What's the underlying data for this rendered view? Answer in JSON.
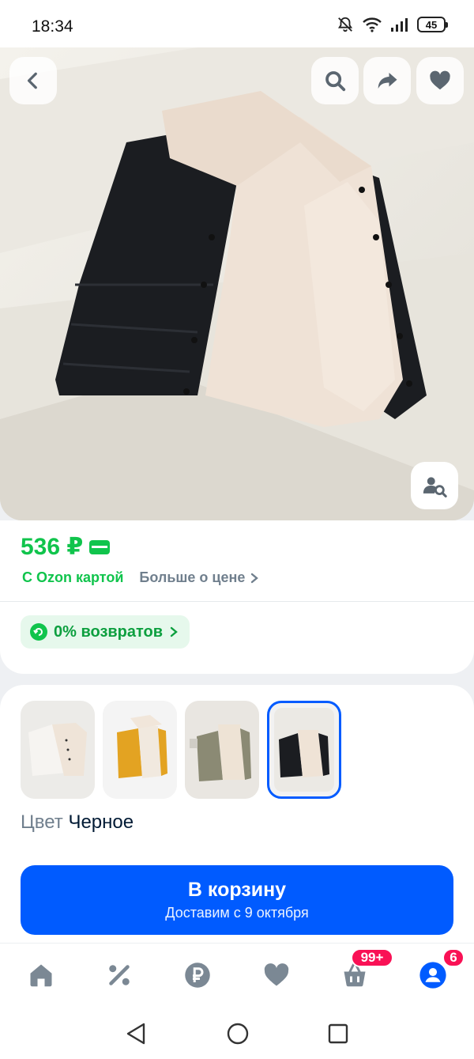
{
  "status_bar": {
    "time": "18:34",
    "battery": "45"
  },
  "product": {
    "price": "536 ₽",
    "price_note": "С Ozon картой",
    "more_price": "Больше о цене",
    "returns": "0% возвратов"
  },
  "variants": {
    "color_label": "Цвет",
    "color_value": "Черное",
    "options": [
      "white",
      "yellow",
      "olive",
      "black"
    ],
    "selected_index": 3
  },
  "cart_button": {
    "title": "В корзину",
    "subtitle": "Доставим с 9 октября"
  },
  "tab_bar": {
    "cart_badge": "99+",
    "profile_badge": "6"
  },
  "colors": {
    "accent": "#005bff",
    "green": "#10c44c",
    "badge": "#f91155"
  },
  "icons": [
    "back-icon",
    "search-icon",
    "share-icon",
    "heart-icon",
    "similar-search-icon",
    "home-icon",
    "percent-icon",
    "ruble-icon",
    "cart-icon",
    "profile-icon"
  ]
}
